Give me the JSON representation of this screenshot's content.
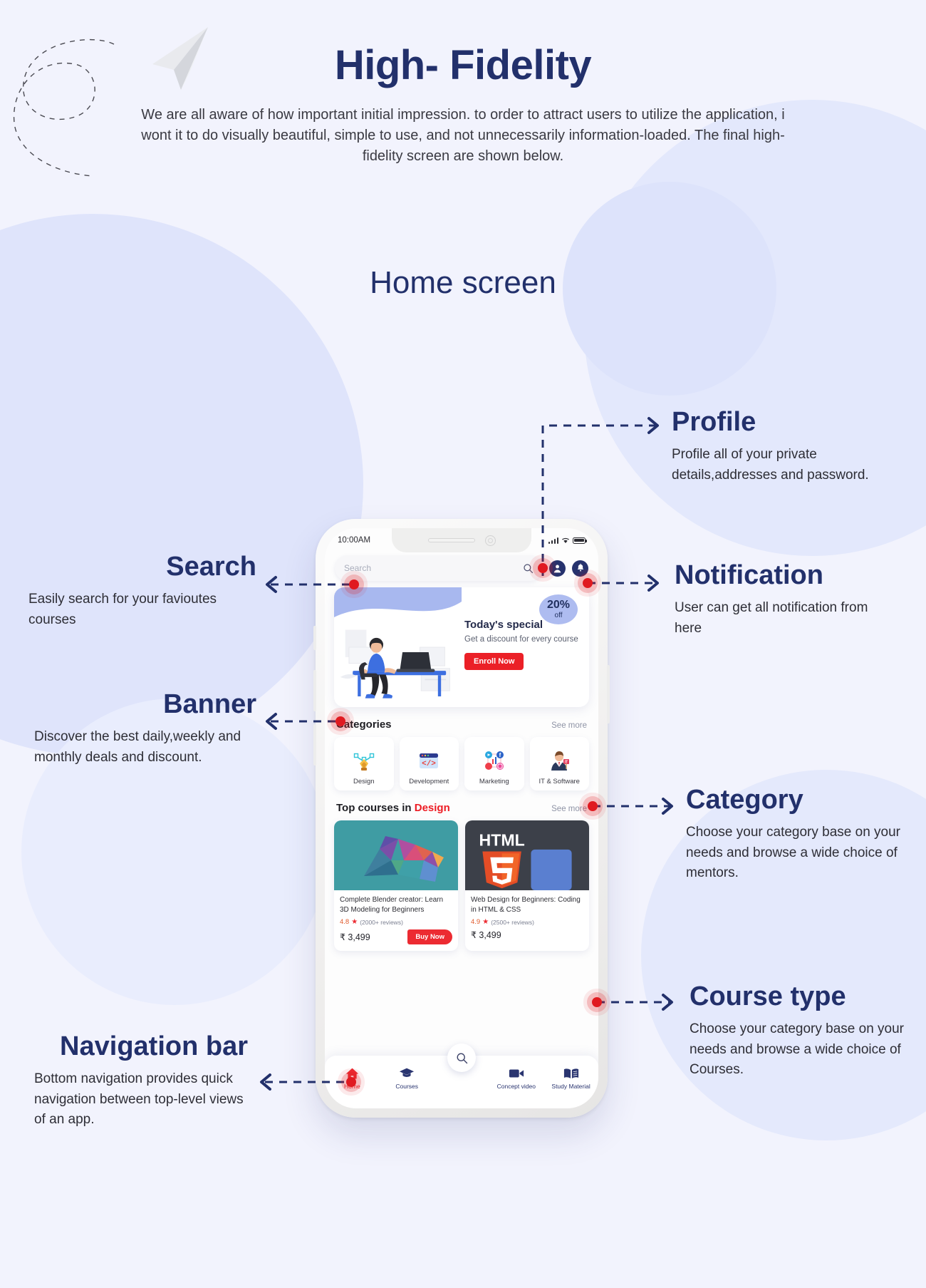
{
  "header": {
    "title": "High- Fidelity",
    "intro": "We are all aware of how important initial impression. to order to attract users to utilize the application, i wont it to do visually beautiful, simple to use, and not unnecessarily information-loaded. The final high-fidelity screen are shown below."
  },
  "section_heading": "Home screen",
  "phone": {
    "status": {
      "time": "10:00AM"
    },
    "search": {
      "placeholder": "Search"
    },
    "banner": {
      "discount_value": "20%",
      "discount_unit": "off",
      "title": "Today's special",
      "subtitle": "Get a discount for every course",
      "cta": "Enroll Now"
    },
    "categories_section": {
      "title": "Categories",
      "see_more": "See more",
      "items": [
        {
          "label": "Design",
          "icon": "pen-tool-icon"
        },
        {
          "label": "Development",
          "icon": "code-window-icon"
        },
        {
          "label": "Marketing",
          "icon": "social-network-icon"
        },
        {
          "label": "IT & Software",
          "icon": "it-person-icon"
        }
      ]
    },
    "courses_section": {
      "title_prefix": "Top courses in ",
      "title_highlight": "Design",
      "see_more": "See more",
      "items": [
        {
          "title": "Complete Blender creator: Learn 3D Modeling for Beginners",
          "rating": "4.8",
          "reviews": "(2000+ reviews)",
          "price": "₹ 3,499",
          "buy_label": "Buy Now",
          "thumb": "low-poly-dinosaur-image"
        },
        {
          "title": "Web Design for Beginners: Coding in HTML & CSS",
          "rating": "4.9",
          "reviews": "(2500+ reviews)",
          "price": "₹ 3,499",
          "buy_label": "",
          "thumb": "html5-logo-image"
        }
      ]
    },
    "navbar": {
      "items": [
        {
          "label": "Home",
          "icon": "home-icon",
          "active": true
        },
        {
          "label": "Courses",
          "icon": "graduation-cap-icon",
          "active": false
        },
        {
          "label": "Concept video",
          "icon": "video-camera-icon",
          "active": false
        },
        {
          "label": "Study Material",
          "icon": "open-book-icon",
          "active": false
        }
      ],
      "fab_icon": "search-icon"
    }
  },
  "annotations": {
    "search": {
      "title": "Search",
      "body": "Easily search for your favioutes courses"
    },
    "banner": {
      "title": "Banner",
      "body": "Discover the best daily,weekly and monthly deals and discount."
    },
    "navigation": {
      "title": "Navigation bar",
      "body": "Bottom navigation provides quick navigation between top-level views of an app."
    },
    "profile": {
      "title": "Profile",
      "body": "Profile all of your private details,addresses and password."
    },
    "notification": {
      "title": "Notification",
      "body": "User can get all notification from here"
    },
    "category": {
      "title": "Category",
      "body": "Choose your category base on your needs and browse a wide choice of mentors."
    },
    "course_type": {
      "title": "Course type",
      "body": "Choose your category base on your needs and browse a wide choice of Courses."
    }
  },
  "colors": {
    "navy": "#22306b",
    "red": "#ec2b32",
    "page_bg": "#f2f3fd",
    "accent_blue": "#aebcf0"
  }
}
